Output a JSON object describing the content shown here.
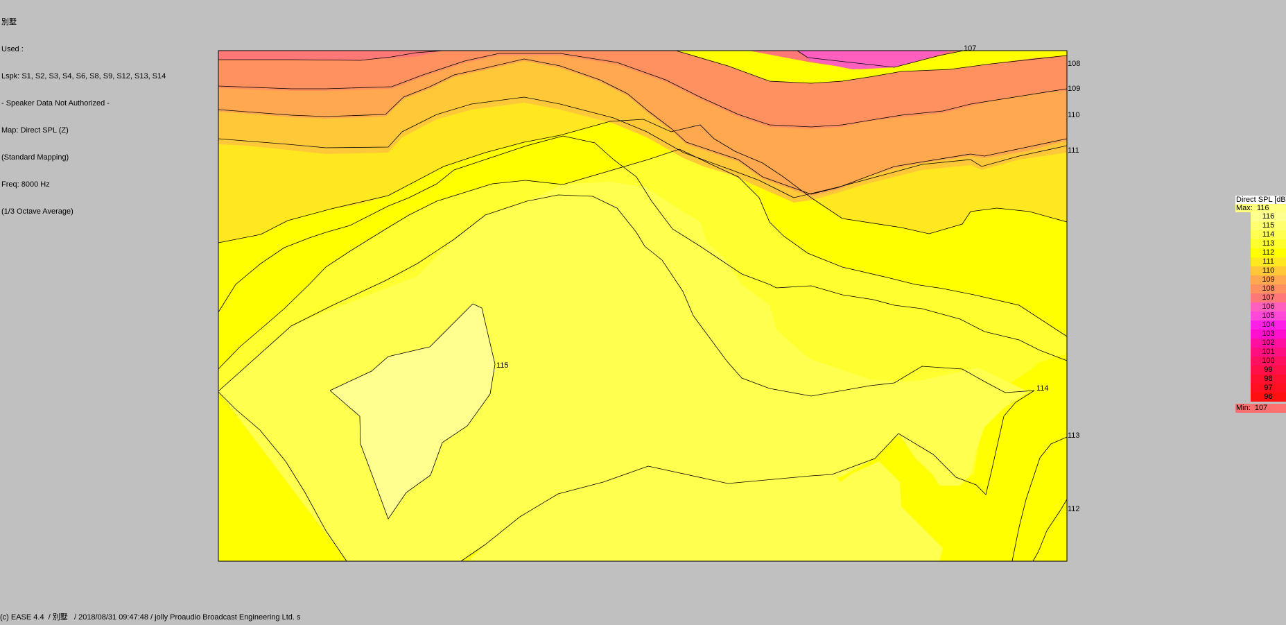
{
  "info": {
    "lines": [
      "別墅",
      "Used :",
      "Lspk: S1, S2, S3, S4, S6, S8, S9, S12, S13, S14",
      "- Speaker Data Not Authorized -",
      "Map: Direct SPL (Z)",
      "(Standard Mapping)",
      "Freq: 8000 Hz",
      "(1/3 Octave Average)"
    ]
  },
  "footer": "(c) EASE 4.4  / 別墅   / 2018/08/31 09:47:48 / jolly Proaudio Broadcast Engineering Ltd. s",
  "legend": {
    "title": "Direct SPL [dB]",
    "max_label": "Max:",
    "max_value": "116",
    "min_label": "Min:",
    "min_value": "107",
    "colors": {
      "116": "#ffff90",
      "115": "#ffff70",
      "114": "#ffff50",
      "113": "#ffff30",
      "112": "#ffff00",
      "111": "#ffe820",
      "110": "#ffc838",
      "109": "#ffa850",
      "108": "#ff9060",
      "107": "#ff7878",
      "106": "#ff60c0",
      "105": "#ff48d8",
      "104": "#ff20e8",
      "103": "#ff10d0",
      "102": "#ff10a0",
      "101": "#ff1080",
      "100": "#ff1060",
      "99": "#ff1048",
      "98": "#ff1030",
      "97": "#ff1020",
      "96": "#ff1010"
    }
  },
  "chart_data": {
    "type": "heatmap",
    "title": "Direct SPL (Z)",
    "unit": "dB",
    "scale_levels": [
      116,
      115,
      114,
      113,
      112,
      111,
      110,
      109,
      108,
      107,
      106,
      105,
      104,
      103,
      102,
      101,
      100,
      99,
      98,
      97,
      96
    ],
    "max": 116,
    "min": 107,
    "contour_labels": [
      {
        "label": "107",
        "level": 107
      },
      {
        "label": "108",
        "level": 108
      },
      {
        "label": "109",
        "level": 109
      },
      {
        "label": "110",
        "level": 110
      },
      {
        "label": "111",
        "level": 111
      },
      {
        "label": "115",
        "level": 115
      },
      {
        "label": "114",
        "level": 114
      },
      {
        "label": "113",
        "level": 113
      },
      {
        "label": "112",
        "level": 112
      }
    ]
  }
}
